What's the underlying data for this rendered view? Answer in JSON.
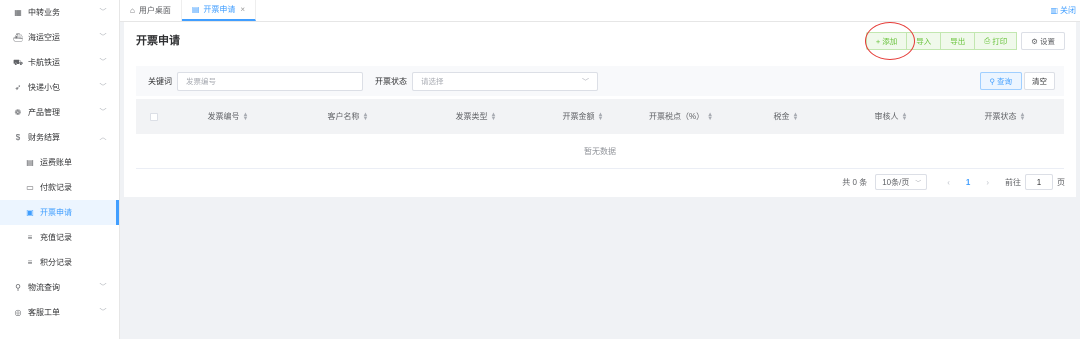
{
  "sidebar": {
    "items": [
      {
        "label": "中转业务",
        "icon": "transfer-icon",
        "glyph": "▦"
      },
      {
        "label": "海运空运",
        "icon": "ship-icon",
        "glyph": "⛴"
      },
      {
        "label": "卡航铁运",
        "icon": "truck-icon",
        "glyph": "⛟"
      },
      {
        "label": "快递小包",
        "icon": "send-icon",
        "glyph": "➶"
      },
      {
        "label": "产品管理",
        "icon": "product-icon",
        "glyph": "❁"
      },
      {
        "label": "财务结算",
        "icon": "dollar-icon",
        "glyph": "$"
      }
    ],
    "sub_items": [
      {
        "label": "运费账单",
        "icon": "document-icon",
        "glyph": "▤"
      },
      {
        "label": "付款记录",
        "icon": "payment-icon",
        "glyph": "▭"
      },
      {
        "label": "开票申请",
        "icon": "invoice-icon",
        "glyph": "▣"
      },
      {
        "label": "充值记录",
        "icon": "list-icon",
        "glyph": "≡"
      },
      {
        "label": "积分记录",
        "icon": "list-icon",
        "glyph": "≡"
      }
    ],
    "bottom_items": [
      {
        "label": "物流查询",
        "icon": "search-icon",
        "glyph": "⚲"
      },
      {
        "label": "客服工单",
        "icon": "eye-icon",
        "glyph": "◎"
      }
    ]
  },
  "tabs": {
    "home": "用户桌面",
    "current": "开票申请",
    "close_all": "关闭"
  },
  "page": {
    "title": "开票申请"
  },
  "toolbar": {
    "add": "添加",
    "import": "导入",
    "export": "导出",
    "print": "打印",
    "settings": "设置"
  },
  "filter": {
    "keyword_label": "关键词",
    "keyword_placeholder": "发票编号",
    "status_label": "开票状态",
    "status_placeholder": "请选择",
    "query": "查询",
    "clear": "清空"
  },
  "table": {
    "columns": [
      "发票编号",
      "客户名称",
      "发票类型",
      "开票金额",
      "开票税点（%）",
      "税金",
      "审核人",
      "开票状态"
    ],
    "empty_text": "暂无数据"
  },
  "pager": {
    "total": "共 0 条",
    "page_size": "10条/页",
    "current_page": "1",
    "goto_label": "前往",
    "goto_value": "1",
    "page_unit": "页"
  },
  "colors": {
    "primary": "#409eff",
    "success": "#67c23a",
    "highlight": "#e53935"
  }
}
